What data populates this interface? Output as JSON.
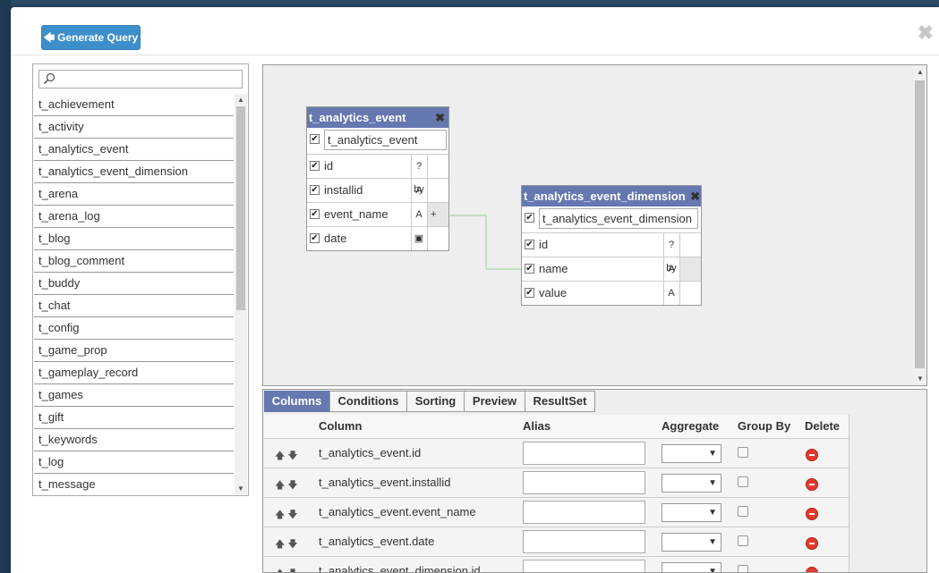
{
  "header": {
    "generate_label": "Generate Query",
    "close_glyph": "✖"
  },
  "table_list": {
    "search_value": "",
    "items": [
      "t_achievement",
      "t_activity",
      "t_analytics_event",
      "t_analytics_event_dimension",
      "t_arena",
      "t_arena_log",
      "t_blog",
      "t_blog_comment",
      "t_buddy",
      "t_chat",
      "t_config",
      "t_game_prop",
      "t_gameplay_record",
      "t_games",
      "t_gift",
      "t_keywords",
      "t_log",
      "t_message"
    ]
  },
  "entities": {
    "event": {
      "title": "t_analytics_event",
      "alias": "t_analytics_event",
      "fields": [
        {
          "name": "id",
          "type": "?by"
        },
        {
          "name": "installid",
          "type": "A"
        },
        {
          "name": "event_name",
          "type": "A",
          "extra": "+"
        },
        {
          "name": "date",
          "type": "▣"
        }
      ]
    },
    "dimension": {
      "title": "t_analytics_event_dimension",
      "alias": "t_analytics_event_dimension",
      "fields": [
        {
          "name": "id",
          "type": "?by"
        },
        {
          "name": "name",
          "type": "A"
        },
        {
          "name": "value",
          "type": "A"
        }
      ]
    }
  },
  "tabs": [
    "Columns",
    "Conditions",
    "Sorting",
    "Preview",
    "ResultSet"
  ],
  "grid": {
    "headers": {
      "column": "Column",
      "alias": "Alias",
      "aggregate": "Aggregate",
      "groupby": "Group By",
      "delete": "Delete"
    },
    "rows": [
      {
        "column": "t_analytics_event.id",
        "alias": ""
      },
      {
        "column": "t_analytics_event.installid",
        "alias": ""
      },
      {
        "column": "t_analytics_event.event_name",
        "alias": ""
      },
      {
        "column": "t_analytics_event.date",
        "alias": ""
      },
      {
        "column": "t_analytics_event_dimension.id",
        "alias": ""
      }
    ]
  },
  "colors": {
    "primary_button": "#3d8fcb",
    "entity_header": "#6678b0",
    "delete_icon": "#e23b2e"
  }
}
